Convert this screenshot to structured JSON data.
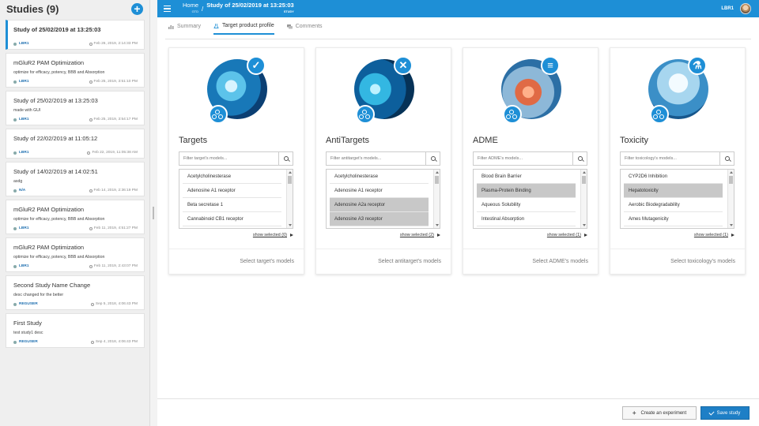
{
  "sidebar": {
    "title": "Studies (9)",
    "add_icon": "plus-icon",
    "studies": [
      {
        "title": "Study of 25/02/2019 at 13:25:03",
        "desc": "",
        "user": "LBR1",
        "date": "Feb 26, 2019, 2:14:33 PM"
      },
      {
        "title": "mGluR2 PAM Optimization",
        "desc": "optimize for efficacy, potency, BBB and Absorption",
        "user": "LBR1",
        "date": "Feb 25, 2019, 3:51:10 PM"
      },
      {
        "title": "Study of 25/02/2019 at 13:25:03",
        "desc": "made with GUI",
        "user": "LBR1",
        "date": "Feb 25, 2019, 3:54:17 PM"
      },
      {
        "title": "Study of 22/02/2019 at 11:05:12",
        "desc": "",
        "user": "LBR1",
        "date": "Feb 22, 2019, 11:05:38 AM"
      },
      {
        "title": "Study of 14/02/2019 at 14:02:51",
        "desc": "asdg",
        "user": "N/A",
        "date": "Feb 14, 2019, 2:36:19 PM"
      },
      {
        "title": "mGluR2 PAM Optimization",
        "desc": "optimize for efficacy, potency, BBB and Absorption",
        "user": "LBR1",
        "date": "Feb 11, 2019, 4:51:27 PM"
      },
      {
        "title": "mGluR2 PAM Optimization",
        "desc": "optimize for efficacy, potency, BBB and Absorption",
        "user": "LBR1",
        "date": "Feb 11, 2019, 2:43:07 PM"
      },
      {
        "title": "Second Study Name Change",
        "desc": "desc changed for the better",
        "user": "REGUSER",
        "date": "Sep 5, 2018, 4:06:43 PM"
      },
      {
        "title": "First Study",
        "desc": "test study1 desc",
        "user": "REGUSER",
        "date": "Sep 4, 2018, 4:06:43 PM"
      }
    ]
  },
  "topbar": {
    "home_label": "Home",
    "home_sub": "GTD",
    "study_label": "Study of 25/02/2019 at 13:25:03",
    "study_sub": "STUDY",
    "user": "LBR1",
    "accent": "#1e8fd6"
  },
  "tabs": [
    {
      "label": "Summary",
      "icon": "bar-chart-icon"
    },
    {
      "label": "Target product profile",
      "icon": "flask-icon"
    },
    {
      "label": "Comments",
      "icon": "comments-icon"
    }
  ],
  "panels": [
    {
      "title": "Targets",
      "badge": "check-icon",
      "placeholder": "Filter target's models...",
      "items": [
        {
          "label": "Acetylcholinesterase",
          "selected": false
        },
        {
          "label": "Adenosine A1 receptor",
          "selected": false
        },
        {
          "label": "Beta secretase 1",
          "selected": false
        },
        {
          "label": "Cannabinoid CB1 receptor",
          "selected": false
        }
      ],
      "show_selected": "show selected (0)",
      "footer": "Select target's models"
    },
    {
      "title": "AntiTargets",
      "badge": "x-icon",
      "placeholder": "Filter antitarget's models...",
      "items": [
        {
          "label": "Acetylcholinesterase",
          "selected": false
        },
        {
          "label": "Adenosine A1 receptor",
          "selected": false
        },
        {
          "label": "Adenosine A2a receptor",
          "selected": true
        },
        {
          "label": "Adenosine A3 receptor",
          "selected": true
        }
      ],
      "show_selected": "show selected (2)",
      "footer": "Select antitarget's models"
    },
    {
      "title": "ADME",
      "badge": "sliders-icon",
      "placeholder": "Filter ADME's models...",
      "items": [
        {
          "label": "Blood Brain Barrier",
          "selected": false
        },
        {
          "label": "Plasma-Protein Binding",
          "selected": true
        },
        {
          "label": "Aqueous Solubility",
          "selected": false
        },
        {
          "label": "Intestinal Absorption",
          "selected": false
        }
      ],
      "show_selected": "show selected (1)",
      "footer": "Select ADME's models"
    },
    {
      "title": "Toxicity",
      "badge": "flask-icon",
      "placeholder": "Filter toxicology's models...",
      "items": [
        {
          "label": "CYP2D6 Inhibition",
          "selected": false
        },
        {
          "label": "Hepatotoxicity",
          "selected": true
        },
        {
          "label": "Aerobic Biodegradability",
          "selected": false
        },
        {
          "label": "Ames Mutagenicity",
          "selected": false
        }
      ],
      "show_selected": "show selected (1)",
      "footer": "Select toxicology's models"
    }
  ],
  "actions": {
    "create_label": "Create an experiment",
    "save_label": "Save study"
  }
}
